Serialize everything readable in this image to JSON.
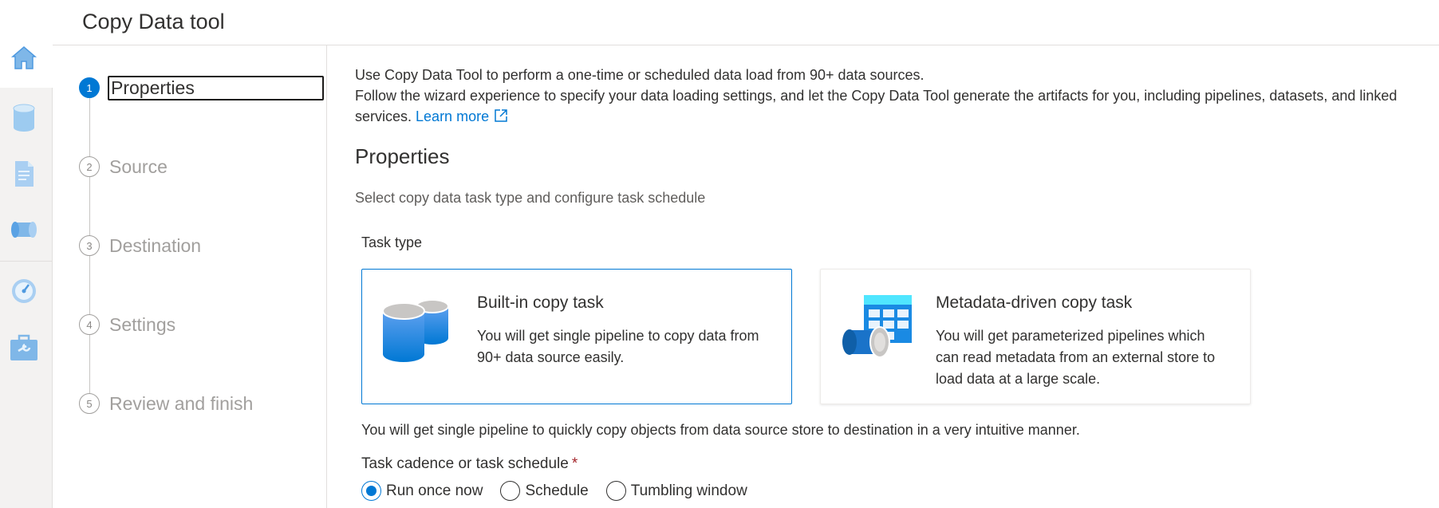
{
  "header": {
    "title": "Copy Data tool"
  },
  "rail": {
    "items": [
      {
        "icon": "home-icon"
      },
      {
        "icon": "database-icon"
      },
      {
        "icon": "document-icon"
      },
      {
        "icon": "pipeline-icon"
      },
      {
        "icon": "monitor-gauge-icon"
      },
      {
        "icon": "toolbox-icon"
      }
    ]
  },
  "steps": [
    {
      "number": "1",
      "label": "Properties",
      "active": true
    },
    {
      "number": "2",
      "label": "Source"
    },
    {
      "number": "3",
      "label": "Destination"
    },
    {
      "number": "4",
      "label": "Settings"
    },
    {
      "number": "5",
      "label": "Review and finish"
    }
  ],
  "intro": {
    "line1": "Use Copy Data Tool to perform a one-time or scheduled data load from 90+ data sources.",
    "line2": "Follow the wizard experience to specify your data loading settings, and let the Copy Data Tool generate the artifacts for you, including pipelines, datasets, and linked services.",
    "learn_more": "Learn more"
  },
  "properties": {
    "title": "Properties",
    "subtitle": "Select copy data task type and configure task schedule",
    "task_type_label": "Task type",
    "cards": [
      {
        "title": "Built-in copy task",
        "description": "You will get single pipeline to copy data from 90+ data source easily.",
        "selected": true
      },
      {
        "title": "Metadata-driven copy task",
        "description": "You will get parameterized pipelines which can read metadata from an external store to load data at a large scale.",
        "selected": false
      }
    ],
    "selected_description": "You will get single pipeline to quickly copy objects from data source store to destination in a very intuitive manner.",
    "cadence_label": "Task cadence or task schedule",
    "required_mark": "*",
    "cadence_options": [
      {
        "label": "Run once now",
        "checked": true
      },
      {
        "label": "Schedule",
        "checked": false
      },
      {
        "label": "Tumbling window",
        "checked": false
      }
    ]
  },
  "colors": {
    "accent": "#0078d4",
    "required": "#a4262c",
    "muted_text": "#a19f9d"
  }
}
